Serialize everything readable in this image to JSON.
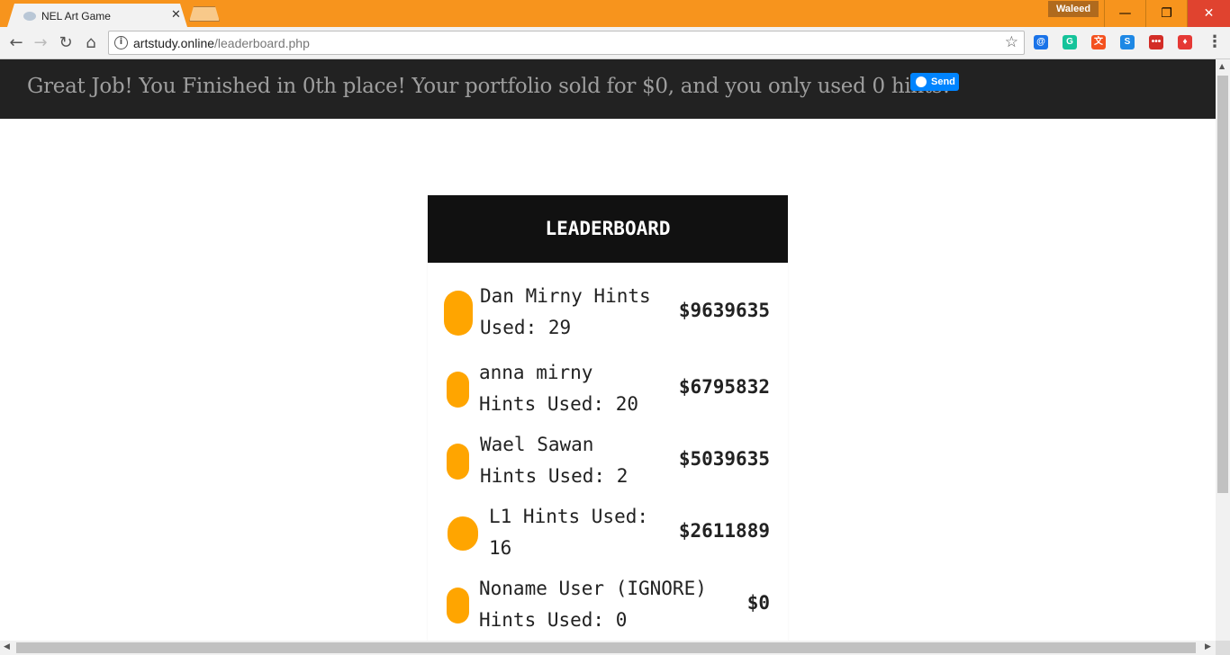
{
  "browser": {
    "tab_title": "NEL Art Game",
    "tab_close": "✕",
    "profile_name": "Waleed",
    "window_controls": {
      "minimize": "—",
      "restore": "❐",
      "close": "✕"
    },
    "nav": {
      "back": "←",
      "forward": "→",
      "reload": "↻",
      "home": "⌂"
    },
    "url_host": "artstudy.online",
    "url_path": "/leaderboard.php",
    "star": "☆",
    "menu": "⋮",
    "extensions": [
      {
        "name": "at-sign-extension",
        "label": "@",
        "color": "#1a73e8"
      },
      {
        "name": "grammarly-extension",
        "label": "G",
        "color": "#15c39a"
      },
      {
        "name": "translate-extension",
        "label": "文",
        "color": "#f4511e"
      },
      {
        "name": "s-extension",
        "label": "S",
        "color": "#1e88e5"
      },
      {
        "name": "lastpass-extension",
        "label": "•••",
        "color": "#d32d27"
      },
      {
        "name": "shield-extension",
        "label": "♦",
        "color": "#e53935"
      }
    ]
  },
  "banner": {
    "message": "Great Job! You Finished in 0th place! Your portfolio sold for $0, and you only used 0 hints!",
    "send_label": "Send",
    "send_color": "#0084ff"
  },
  "leaderboard": {
    "title": "LEADERBOARD",
    "accent_color": "#ffa500",
    "entries": [
      {
        "line1": "Dan Mirny Hints",
        "line2": "Used: 29",
        "amount": "$9639635"
      },
      {
        "line1": "anna mirny",
        "line2": "Hints Used: 20",
        "amount": "$6795832"
      },
      {
        "line1": "Wael Sawan",
        "line2": "Hints Used: 2",
        "amount": "$5039635"
      },
      {
        "line1": "L1 Hints Used:",
        "line2": "16",
        "amount": "$2611889"
      },
      {
        "line1": "Noname User (IGNORE)",
        "line2": "Hints Used: 0",
        "amount": "$0"
      }
    ]
  }
}
